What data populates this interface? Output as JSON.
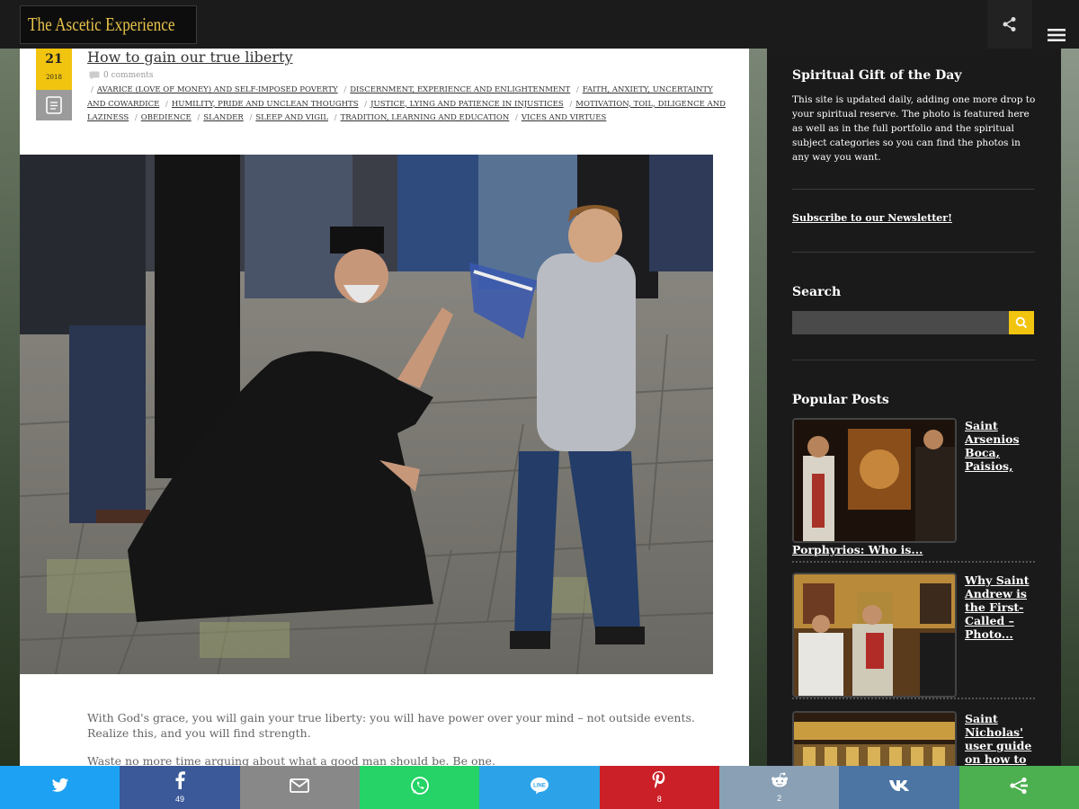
{
  "header": {
    "site_title": "The Ascetic Experience"
  },
  "post": {
    "date_day": "21",
    "date_year": "2018",
    "title": "How to gain our true liberty",
    "comments": "0 comments",
    "categories": [
      "Avarice (love of money) and self-imposed poverty",
      "Discernment, experience and enlightenment",
      "Faith, anxiety, uncertainty and cowardice",
      "Humility, pride and unclean thoughts",
      "Justice, lying and patience in injustices",
      "Motivation, toil, diligence and laziness",
      "Obedience",
      "Slander",
      "Sleep and vigil",
      "Tradition, learning and education",
      "Vices and virtues"
    ],
    "paragraphs": [
      "With God's grace, you will gain your true liberty: you will have power over your mind – not outside events. Realize this, and you will find strength.",
      "Waste no more time arguing about what a good man should be. Be one."
    ]
  },
  "sidebar": {
    "gift_title": "Spiritual Gift of the Day",
    "gift_text": "This site is updated daily, adding one more drop to your spiritual reserve. The photo is featured here as well as in the full portfolio and the spiritual subject categories so you can find the photos in any way you want.",
    "newsletter": "Subscribe to our Newsletter!",
    "search_title": "Search",
    "search_placeholder": "",
    "popular_title": "Popular Posts",
    "popular": [
      {
        "title_side": "Saint Arsenios Boca, Paisios,",
        "title_below": "Porphyrios: Who is..."
      },
      {
        "title_side": "Why Saint Andrew is the First-Called – Photo..."
      },
      {
        "title_side": "Saint Nicholas' user guide on how to"
      }
    ]
  },
  "share_bar": {
    "buttons": [
      {
        "network": "twitter",
        "icon": "twitter-icon",
        "color": "#1da1f2",
        "count": ""
      },
      {
        "network": "facebook",
        "icon": "facebook-icon",
        "color": "#3b5998",
        "count": "49"
      },
      {
        "network": "email",
        "icon": "email-icon",
        "color": "#888888",
        "count": ""
      },
      {
        "network": "whatsapp",
        "icon": "whatsapp-icon",
        "color": "#25d366",
        "count": ""
      },
      {
        "network": "line",
        "icon": "line-icon",
        "color": "#2ca3e8",
        "count": ""
      },
      {
        "network": "pinterest",
        "icon": "pinterest-icon",
        "color": "#cb2027",
        "count": "8"
      },
      {
        "network": "reddit",
        "icon": "reddit-icon",
        "color": "#8aa0b4",
        "count": "2"
      },
      {
        "network": "vk",
        "icon": "vk-icon",
        "color": "#4c75a3",
        "count": ""
      },
      {
        "network": "more",
        "icon": "more-icon",
        "color": "#4caf50",
        "count": ""
      }
    ]
  },
  "colors": {
    "accent": "#f1c40f",
    "sidebar_bg": "#1a1a1a",
    "topbar_bg": "#1b1b1b"
  }
}
